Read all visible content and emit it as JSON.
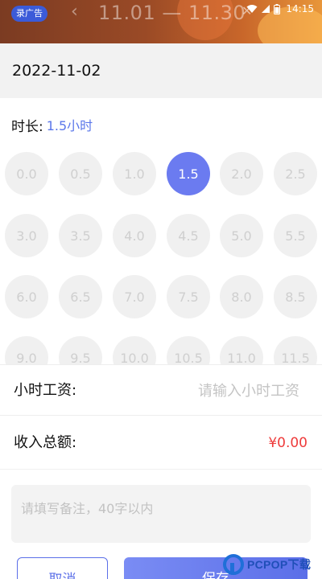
{
  "ad_banner": {
    "badge": "录广告",
    "back_icon": "chevron-left-icon",
    "date_range": "11.01 — 11.30",
    "close_icon": "close-icon"
  },
  "status_bar": {
    "time": "14:15",
    "icons": [
      "wifi-icon",
      "signal-icon",
      "battery-icon"
    ]
  },
  "record": {
    "date": "2022-11-02",
    "duration_label": "时长:",
    "duration_value": "1.5小时"
  },
  "hour_options": [
    "0.0",
    "0.5",
    "1.0",
    "1.5",
    "2.0",
    "2.5",
    "3.0",
    "3.5",
    "4.0",
    "4.5",
    "5.0",
    "5.5",
    "6.0",
    "6.5",
    "7.0",
    "7.5",
    "8.0",
    "8.5",
    "9.0",
    "9.5",
    "10.0",
    "10.5",
    "11.0",
    "11.5"
  ],
  "selected_hour": "1.5",
  "wage": {
    "label": "小时工资:",
    "placeholder": "请输入小时工资",
    "value": ""
  },
  "total": {
    "label": "收入总额:",
    "value": "¥0.00"
  },
  "notes": {
    "placeholder": "请填写备注，40字以内",
    "value": ""
  },
  "buttons": {
    "cancel": "取消",
    "save": "保存"
  },
  "watermark": {
    "text": "PCPOP下载"
  },
  "colors": {
    "accent": "#5b6fe8",
    "selected_chip": "#6b7bf0",
    "amount": "#ee3b3b",
    "placeholder": "#c4c4c4"
  }
}
